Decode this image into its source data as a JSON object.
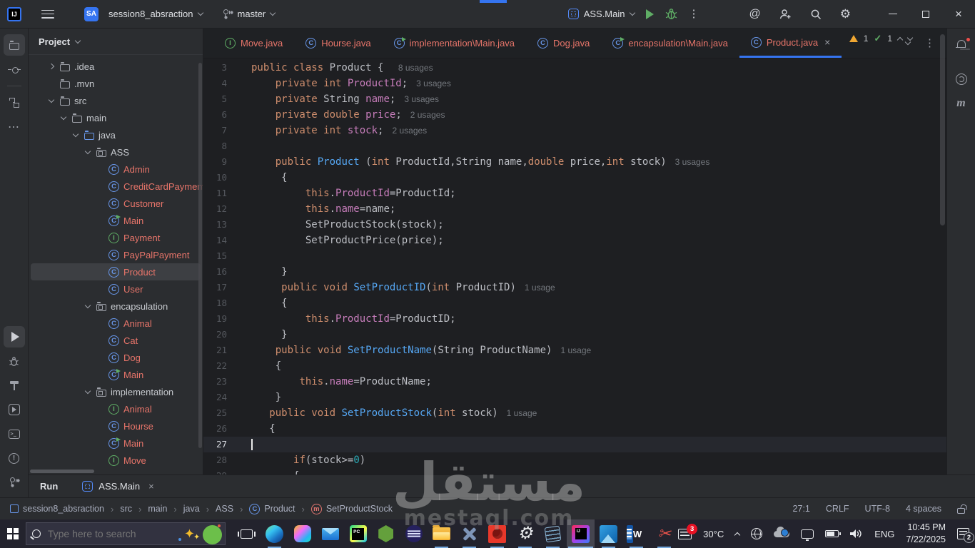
{
  "colors": {
    "accent": "#3574f0",
    "file_label": "#e8756a",
    "keyword": "#cf8e6d",
    "field": "#c77dbb",
    "method_decl": "#56a8f5",
    "number": "#2aacb8",
    "plain_text": "#bcbec4",
    "run_green": "#5fad65"
  },
  "titlebar": {
    "avatar": "SA",
    "project_button": "session8_absraction",
    "branch": "master",
    "run_config": "ASS.Main"
  },
  "tabbar": {
    "tabs": [
      {
        "label": "Move.java",
        "icon": "interface"
      },
      {
        "label": "Hourse.java",
        "icon": "class"
      },
      {
        "label": "implementation\\Main.java",
        "icon": "runnable"
      },
      {
        "label": "Dog.java",
        "icon": "class"
      },
      {
        "label": "encapsulation\\Main.java",
        "icon": "runnable"
      },
      {
        "label": "Product.java",
        "icon": "class",
        "active": true,
        "closable": true
      }
    ]
  },
  "project_panel": {
    "header": "Project",
    "items": [
      {
        "label": ".idea",
        "depth": 1,
        "icon": "folder",
        "chevron": "right"
      },
      {
        "label": ".mvn",
        "depth": 1,
        "icon": "folder"
      },
      {
        "label": "src",
        "depth": 1,
        "icon": "folder",
        "chevron": "down"
      },
      {
        "label": "main",
        "depth": 2,
        "icon": "folder",
        "chevron": "down"
      },
      {
        "label": "java",
        "depth": 3,
        "icon": "folder-src",
        "chevron": "down"
      },
      {
        "label": "ASS",
        "depth": 4,
        "icon": "package",
        "chevron": "down"
      },
      {
        "label": "Admin",
        "depth": 5,
        "icon": "class",
        "file": true
      },
      {
        "label": "CreditCardPayment",
        "depth": 5,
        "icon": "class",
        "file": true
      },
      {
        "label": "Customer",
        "depth": 5,
        "icon": "class",
        "file": true
      },
      {
        "label": "Main",
        "depth": 5,
        "icon": "runnable",
        "file": true
      },
      {
        "label": "Payment",
        "depth": 5,
        "icon": "interface",
        "file": true
      },
      {
        "label": "PayPalPayment",
        "depth": 5,
        "icon": "class",
        "file": true
      },
      {
        "label": "Product",
        "depth": 5,
        "icon": "class",
        "file": true,
        "selected": true
      },
      {
        "label": "User",
        "depth": 5,
        "icon": "class",
        "file": true
      },
      {
        "label": "encapsulation",
        "depth": 4,
        "icon": "package",
        "chevron": "down"
      },
      {
        "label": "Animal",
        "depth": 5,
        "icon": "class",
        "file": true
      },
      {
        "label": "Cat",
        "depth": 5,
        "icon": "class",
        "file": true
      },
      {
        "label": "Dog",
        "depth": 5,
        "icon": "class",
        "file": true
      },
      {
        "label": "Main",
        "depth": 5,
        "icon": "runnable",
        "file": true
      },
      {
        "label": "implementation",
        "depth": 4,
        "icon": "package",
        "chevron": "down"
      },
      {
        "label": "Animal",
        "depth": 5,
        "icon": "interface",
        "file": true
      },
      {
        "label": "Hourse",
        "depth": 5,
        "icon": "class",
        "file": true
      },
      {
        "label": "Main",
        "depth": 5,
        "icon": "runnable",
        "file": true
      },
      {
        "label": "Move",
        "depth": 5,
        "icon": "interface",
        "file": true
      }
    ]
  },
  "editor": {
    "caret_line": 27,
    "inspections": {
      "warnings": "1",
      "passed": "1"
    },
    "lines": [
      {
        "n": 3,
        "tokens": [
          [
            "kw",
            "public class "
          ],
          [
            "pl",
            "Product { "
          ],
          [
            "us",
            "8 usages"
          ]
        ]
      },
      {
        "n": 4,
        "tokens": [
          [
            "pl",
            "    "
          ],
          [
            "kw",
            "private int "
          ],
          [
            "fd",
            "ProductId"
          ],
          [
            "pl",
            ";"
          ],
          [
            "us",
            "3 usages"
          ]
        ]
      },
      {
        "n": 5,
        "tokens": [
          [
            "pl",
            "    "
          ],
          [
            "kw",
            "private "
          ],
          [
            "pl",
            "String "
          ],
          [
            "fd",
            "name"
          ],
          [
            "pl",
            ";"
          ],
          [
            "us",
            "3 usages"
          ]
        ]
      },
      {
        "n": 6,
        "tokens": [
          [
            "pl",
            "    "
          ],
          [
            "kw",
            "private double "
          ],
          [
            "fd",
            "price"
          ],
          [
            "pl",
            ";"
          ],
          [
            "us",
            "2 usages"
          ]
        ]
      },
      {
        "n": 7,
        "tokens": [
          [
            "pl",
            "    "
          ],
          [
            "kw",
            "private int "
          ],
          [
            "fd",
            "stock"
          ],
          [
            "pl",
            ";"
          ],
          [
            "us",
            "2 usages"
          ]
        ]
      },
      {
        "n": 8,
        "tokens": []
      },
      {
        "n": 9,
        "tokens": [
          [
            "pl",
            "    "
          ],
          [
            "kw",
            "public "
          ],
          [
            "mt",
            "Product "
          ],
          [
            "pl",
            "("
          ],
          [
            "kw",
            "int "
          ],
          [
            "pl",
            "ProductId,String name,"
          ],
          [
            "kw",
            "double "
          ],
          [
            "pl",
            "price,"
          ],
          [
            "kw",
            "int "
          ],
          [
            "pl",
            "stock)"
          ],
          [
            "us",
            "3 usages"
          ]
        ]
      },
      {
        "n": 10,
        "tokens": [
          [
            "pl",
            "     {"
          ]
        ]
      },
      {
        "n": 11,
        "tokens": [
          [
            "pl",
            "         "
          ],
          [
            "kw",
            "this"
          ],
          [
            "pl",
            "."
          ],
          [
            "fd",
            "ProductId"
          ],
          [
            "pl",
            "=ProductId;"
          ]
        ]
      },
      {
        "n": 12,
        "tokens": [
          [
            "pl",
            "         "
          ],
          [
            "kw",
            "this"
          ],
          [
            "pl",
            "."
          ],
          [
            "fd",
            "name"
          ],
          [
            "pl",
            "=name;"
          ]
        ]
      },
      {
        "n": 13,
        "tokens": [
          [
            "pl",
            "         SetProductStock(stock);"
          ]
        ]
      },
      {
        "n": 14,
        "tokens": [
          [
            "pl",
            "         SetProductPrice(price);"
          ]
        ]
      },
      {
        "n": 15,
        "tokens": []
      },
      {
        "n": 16,
        "tokens": [
          [
            "pl",
            "     }"
          ]
        ]
      },
      {
        "n": 17,
        "tokens": [
          [
            "pl",
            "     "
          ],
          [
            "kw",
            "public void "
          ],
          [
            "mt",
            "SetProductID"
          ],
          [
            "pl",
            "("
          ],
          [
            "kw",
            "int "
          ],
          [
            "pl",
            "ProductID)"
          ],
          [
            "us",
            "1 usage"
          ]
        ]
      },
      {
        "n": 18,
        "tokens": [
          [
            "pl",
            "     {"
          ]
        ]
      },
      {
        "n": 19,
        "tokens": [
          [
            "pl",
            "         "
          ],
          [
            "kw",
            "this"
          ],
          [
            "pl",
            "."
          ],
          [
            "fd",
            "ProductId"
          ],
          [
            "pl",
            "=ProductID;"
          ]
        ]
      },
      {
        "n": 20,
        "tokens": [
          [
            "pl",
            "     }"
          ]
        ]
      },
      {
        "n": 21,
        "tokens": [
          [
            "pl",
            "    "
          ],
          [
            "kw",
            "public void "
          ],
          [
            "mt",
            "SetProductName"
          ],
          [
            "pl",
            "(String ProductName)"
          ],
          [
            "us",
            "1 usage"
          ]
        ]
      },
      {
        "n": 22,
        "tokens": [
          [
            "pl",
            "    {"
          ]
        ]
      },
      {
        "n": 23,
        "tokens": [
          [
            "pl",
            "        "
          ],
          [
            "kw",
            "this"
          ],
          [
            "pl",
            "."
          ],
          [
            "fd",
            "name"
          ],
          [
            "pl",
            "=ProductName;"
          ]
        ]
      },
      {
        "n": 24,
        "tokens": [
          [
            "pl",
            "    }"
          ]
        ]
      },
      {
        "n": 25,
        "tokens": [
          [
            "pl",
            "   "
          ],
          [
            "kw",
            "public void "
          ],
          [
            "mt",
            "SetProductStock"
          ],
          [
            "pl",
            "("
          ],
          [
            "kw",
            "int "
          ],
          [
            "pl",
            "stock)"
          ],
          [
            "us",
            "1 usage"
          ]
        ]
      },
      {
        "n": 26,
        "tokens": [
          [
            "pl",
            "   {"
          ]
        ]
      },
      {
        "n": 27,
        "tokens": []
      },
      {
        "n": 28,
        "tokens": [
          [
            "pl",
            "       "
          ],
          [
            "kw",
            "if"
          ],
          [
            "pl",
            "(stock>="
          ],
          [
            "nm",
            "0"
          ],
          [
            "pl",
            ")"
          ]
        ]
      },
      {
        "n": 29,
        "tokens": [
          [
            "pl",
            "       {"
          ]
        ]
      }
    ]
  },
  "run_panel": {
    "title": "Run",
    "tab": "ASS.Main"
  },
  "statusbar": {
    "breadcrumbs": [
      {
        "label": "session8_absraction",
        "icon": "module"
      },
      {
        "label": "src"
      },
      {
        "label": "main"
      },
      {
        "label": "java"
      },
      {
        "label": "ASS"
      },
      {
        "label": "Product",
        "icon": "class"
      },
      {
        "label": "SetProductStock",
        "icon": "method"
      }
    ],
    "caret_position": "27:1",
    "line_ending": "CRLF",
    "encoding": "UTF-8",
    "indent": "4 spaces"
  },
  "taskbar": {
    "search_placeholder": "Type here to search",
    "apps": [
      {
        "name": "task-view"
      },
      {
        "name": "edge",
        "running": true
      },
      {
        "name": "copilot"
      },
      {
        "name": "mail"
      },
      {
        "name": "pycharm"
      },
      {
        "name": "spyder"
      },
      {
        "name": "eclipse"
      },
      {
        "name": "file-explorer",
        "running": true
      },
      {
        "name": "drone",
        "running": true
      },
      {
        "name": "ladybug",
        "running": true
      },
      {
        "name": "settings",
        "running": true
      },
      {
        "name": "notepad",
        "running": true
      },
      {
        "name": "intellij",
        "running": true,
        "active": true
      },
      {
        "name": "photos",
        "running": true
      },
      {
        "name": "word",
        "running": true
      },
      {
        "name": "snip",
        "running": true
      }
    ],
    "tray": {
      "widgets_badge": "3",
      "temperature": "30°C",
      "language": "ENG",
      "time": "10:45 PM",
      "date": "7/22/2025",
      "notifications_badge": "2"
    }
  },
  "watermark": {
    "line1": "مستقل",
    "line2": "mestaql.com"
  }
}
